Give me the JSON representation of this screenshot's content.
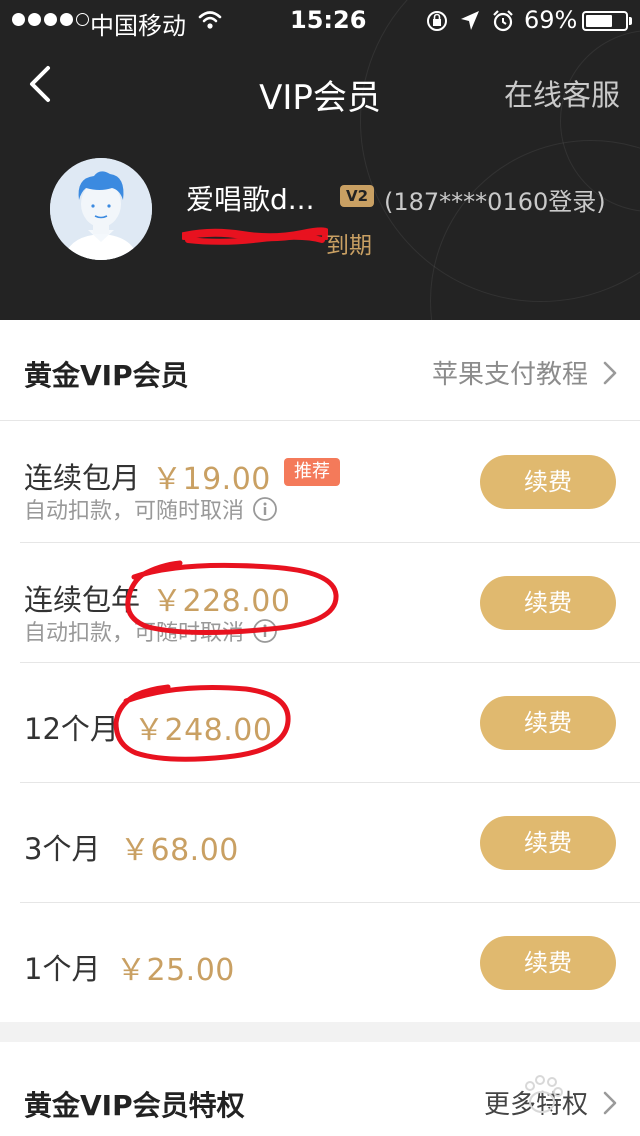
{
  "status_bar": {
    "carrier": "中国移动",
    "time": "15:26",
    "battery": "69%",
    "battery_level": 0.69
  },
  "nav": {
    "title": "VIP会员",
    "service_label": "在线客服"
  },
  "profile": {
    "username": "爱唱歌d...",
    "vip_level": "V2",
    "login_info": "(187****0160登录)",
    "expire_label": "到期"
  },
  "gold_section": {
    "title": "黄金VIP会员",
    "tutorial_link": "苹果支付教程"
  },
  "plans": [
    {
      "label": "连续包月",
      "price": "￥19.00",
      "tag": "推荐",
      "subtitle": "自动扣款，可随时取消",
      "button": "续费"
    },
    {
      "label": "连续包年",
      "price": "￥228.00",
      "subtitle": "自动扣款，可随时取消",
      "button": "续费"
    },
    {
      "label": "12个月",
      "price": "￥248.00",
      "button": "续费"
    },
    {
      "label": "3个月",
      "price": "￥68.00",
      "button": "续费"
    },
    {
      "label": "1个月",
      "price": "￥25.00",
      "button": "续费"
    }
  ],
  "privileges_section": {
    "title": "黄金VIP会员特权",
    "more_link": "更多特权"
  },
  "colors": {
    "header_bg": "#232323",
    "gold_text": "#c9a063",
    "button_gold": "#e0b96f",
    "tag_red": "#f47a5a",
    "annotation_red": "#e8121f"
  }
}
